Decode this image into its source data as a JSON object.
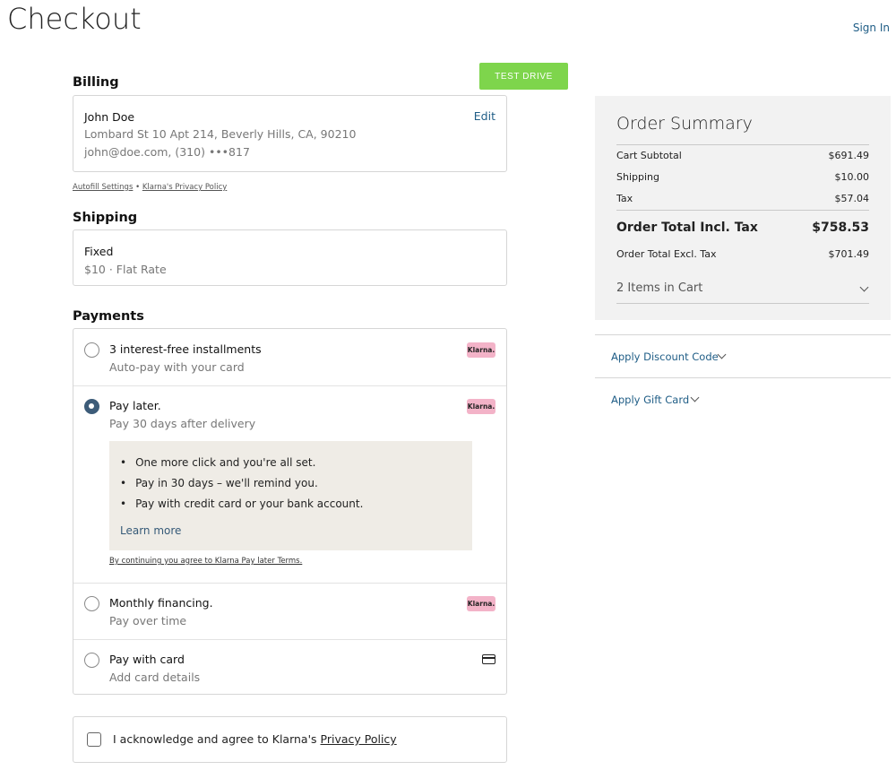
{
  "header": {
    "title": "Checkout",
    "sign_in": "Sign In"
  },
  "test_drive": "TEST DRIVE",
  "billing": {
    "heading": "Billing",
    "name": "John Doe",
    "address": "Lombard St 10 Apt 214, Beverly Hills, CA, 90210",
    "contact": "john@doe.com, (310) •••817",
    "edit": "Edit",
    "autofill": "Autofill Settings",
    "separator": "•",
    "privacy": "Klarna's Privacy Policy"
  },
  "shipping": {
    "heading": "Shipping",
    "method": "Fixed",
    "detail": "$10 · Flat Rate"
  },
  "payments": {
    "heading": "Payments",
    "options": [
      {
        "title": "3 interest-free installments",
        "subtitle": "Auto-pay with your card",
        "badge": "Klarna.",
        "selected": false
      },
      {
        "title": "Pay later.",
        "subtitle": "Pay 30 days after delivery",
        "badge": "Klarna.",
        "selected": true
      },
      {
        "title": "Monthly financing.",
        "subtitle": "Pay over time",
        "badge": "Klarna.",
        "selected": false
      },
      {
        "title": "Pay with card",
        "subtitle": "Add card details",
        "icon": "credit-card-icon",
        "selected": false
      }
    ],
    "pay_later_info": {
      "bullets": [
        "One more click and you're all set.",
        "Pay in 30 days – we'll remind you.",
        "Pay with credit card or your bank account."
      ],
      "learn_more": "Learn more",
      "terms": "By continuing you agree to Klarna Pay later Terms."
    }
  },
  "acknowledge": {
    "text": "I acknowledge and agree to Klarna's ",
    "link": "Privacy Policy"
  },
  "order_summary": {
    "title": "Order Summary",
    "rows": [
      {
        "label": "Cart Subtotal",
        "value": "$691.49"
      },
      {
        "label": "Shipping",
        "value": "$10.00"
      },
      {
        "label": "Tax",
        "value": "$57.04"
      }
    ],
    "total_incl": {
      "label": "Order Total Incl. Tax",
      "value": "$758.53"
    },
    "total_excl": {
      "label": "Order Total Excl. Tax",
      "value": "$701.49"
    },
    "items": "2 Items in Cart"
  },
  "discount": "Apply Discount Code",
  "gift_card": "Apply Gift Card",
  "colors": {
    "accent_link": "#1f5d86",
    "test_drive_bg": "#7ed54c",
    "klarna_pink": "#f3b3c8",
    "info_bg": "#efece6"
  }
}
